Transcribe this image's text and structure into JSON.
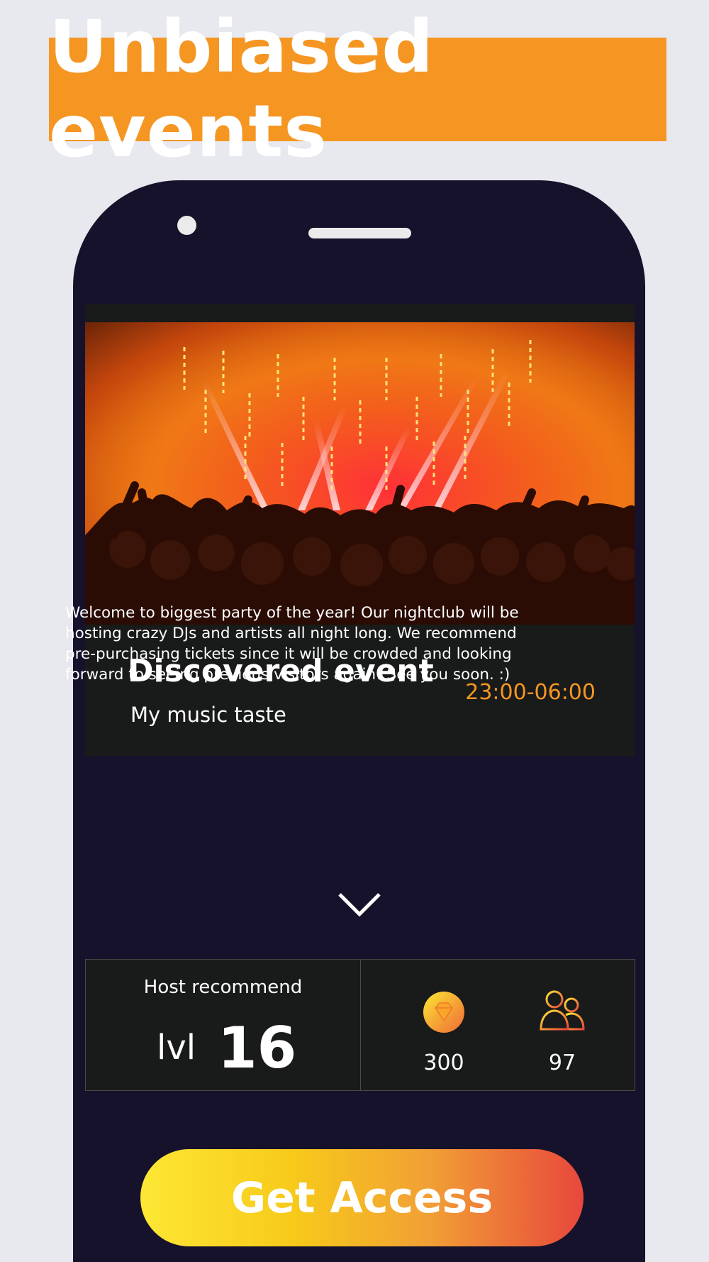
{
  "banner": {
    "title": "Unbiased events"
  },
  "event": {
    "title": "Discovered event",
    "subtitle": "My music taste",
    "time": "23:00-06:00",
    "description": "Welcome to biggest party of the year! Our nightclub will be hosting crazy DJs and artists all night long. We recommend pre-purchasing tickets since it will be crowded and looking forward to seeing previous visitors again! See you soon. :)"
  },
  "stats": {
    "host_label": "Host recommend",
    "level_label": "lvl",
    "level_value": "16",
    "gems": "300",
    "attendees": "97"
  },
  "cta": {
    "label": "Get Access"
  },
  "icons": {
    "expand": "chevron-down-icon",
    "gems": "diamond-icon",
    "attendees": "people-icon"
  },
  "colors": {
    "accent": "#f59623",
    "phone": "#17122b",
    "card": "#191a1a",
    "background": "#e8e9ee"
  }
}
